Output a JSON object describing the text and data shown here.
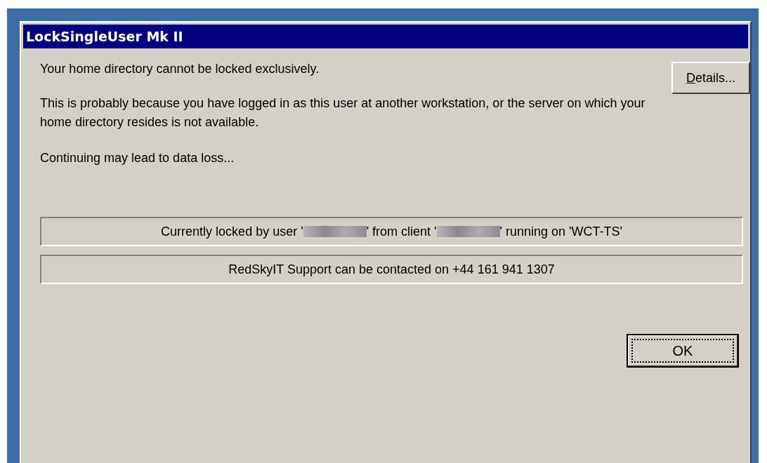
{
  "window": {
    "title": "LockSingleUser Mk II"
  },
  "message": [
    "Your home directory cannot be locked exclusively.",
    "This is probably because you have logged in as this user at another workstation, or the server on which your home directory resides is not available.",
    "Continuing may lead to data loss..."
  ],
  "details_button": "Details...",
  "status_lines": [
    {
      "kind": "redacted",
      "parts": [
        "Currently locked by user '",
        "' from client '",
        "' running on 'WCT-TS'"
      ]
    },
    {
      "kind": "plain",
      "parts": [
        "RedSkyIT Support can be contacted on +44 161 941 1307"
      ]
    }
  ],
  "ok_button": {
    "label": "OK",
    "focused": true
  }
}
